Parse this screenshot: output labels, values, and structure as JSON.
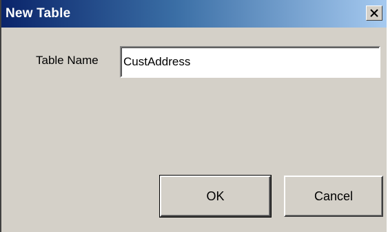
{
  "window": {
    "title": "New Table"
  },
  "form": {
    "table_name_label": "Table Name",
    "table_name_value": "CustAddress"
  },
  "buttons": {
    "ok_label": "OK",
    "cancel_label": "Cancel"
  },
  "colors": {
    "titlebar_start": "#0a246a",
    "titlebar_end": "#a6caf0",
    "dialog_face": "#d4d0c8"
  },
  "icons": {
    "close": "close-icon"
  }
}
